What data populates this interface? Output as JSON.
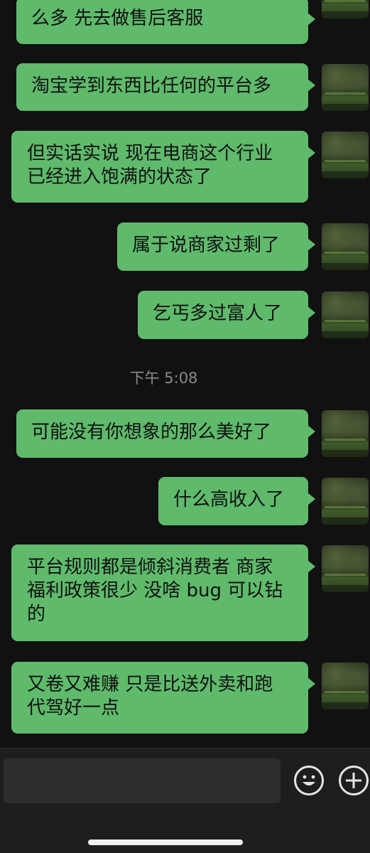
{
  "messages": [
    {
      "text": "么多 先去做售后客服"
    },
    {
      "text": "淘宝学到东西比任何的平台多"
    },
    {
      "text": "但实话实说 现在电商这个行业\n已经进入饱满的状态了"
    },
    {
      "text": "属于说商家过剩了"
    },
    {
      "text": "乞丐多过富人了"
    },
    {
      "text": "可能没有你想象的那么美好了"
    },
    {
      "text": "什么高收入了"
    },
    {
      "text": "平台规则都是倾斜消费者 商家\n福利政策很少 没啥 bug 可以钻\n的"
    },
    {
      "text": "又卷又难赚 只是比送外卖和跑\n代驾好一点"
    }
  ],
  "timestamp": "下午 5:08",
  "input_bar": {
    "message_value": "",
    "emoji_icon": "smiley-face-icon",
    "plus_icon": "plus-circle-icon"
  },
  "colors": {
    "background": "#111111",
    "bubble_green": "#5fba6b",
    "timestamp_gray": "#8a8a8a",
    "input_bar": "#1e1e1e"
  }
}
